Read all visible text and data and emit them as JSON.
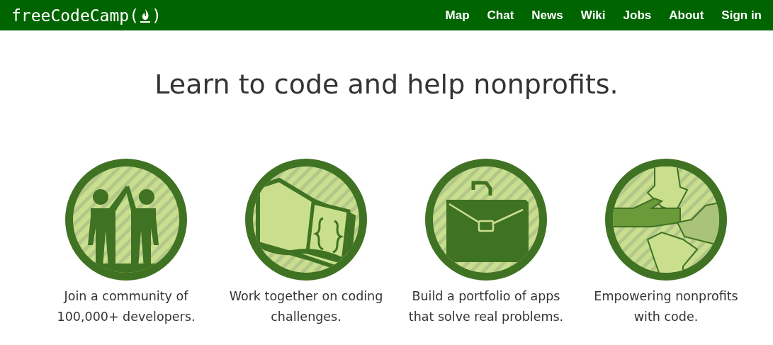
{
  "logo": {
    "before": "freeCodeCamp(",
    "after": ")"
  },
  "nav": [
    "Map",
    "Chat",
    "News",
    "Wiki",
    "Jobs",
    "About",
    "Sign in"
  ],
  "headline": "Learn to code and help nonprofits.",
  "features": [
    {
      "kind": "people",
      "lines": [
        "Join a community of",
        "100,000+ developers."
      ]
    },
    {
      "kind": "book",
      "lines": [
        "Work together on coding",
        "challenges."
      ]
    },
    {
      "kind": "briefcase",
      "lines": [
        "Build a portfolio of apps",
        "that solve real problems."
      ]
    },
    {
      "kind": "hands",
      "lines": [
        "Empowering nonprofits",
        "with code."
      ]
    }
  ]
}
